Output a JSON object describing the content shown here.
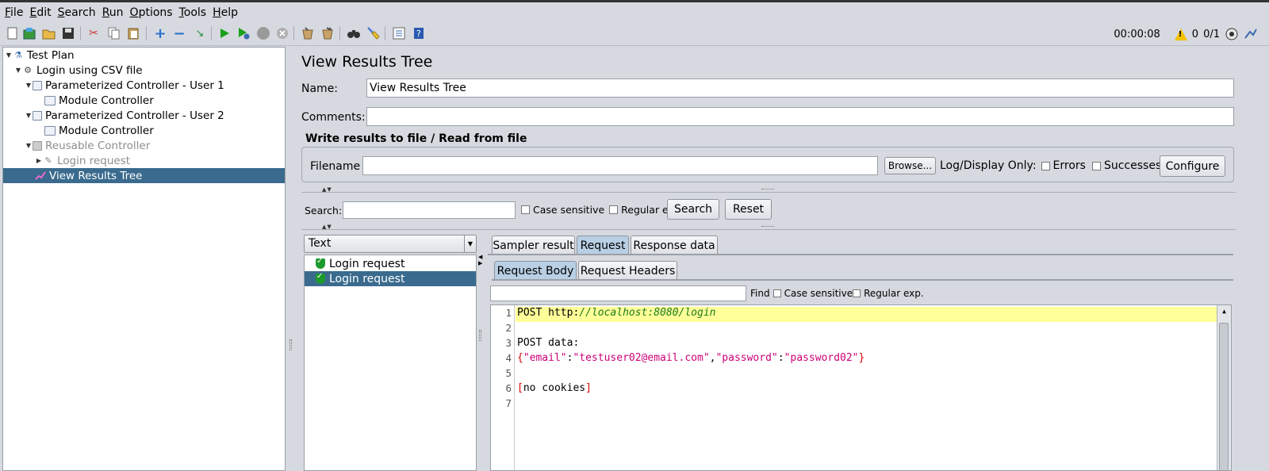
{
  "menu": [
    {
      "u": "F",
      "rest": "ile"
    },
    {
      "u": "E",
      "rest": "dit"
    },
    {
      "u": "S",
      "rest": "earch"
    },
    {
      "u": "R",
      "rest": "un"
    },
    {
      "u": "O",
      "rest": "ptions"
    },
    {
      "u": "T",
      "rest": "ools"
    },
    {
      "u": "H",
      "rest": "elp"
    }
  ],
  "status": {
    "timer": "00:00:08",
    "warnings": "0",
    "threads": "0/1"
  },
  "tree": {
    "items": [
      {
        "label": "Test Plan",
        "icon": "flask-icon"
      },
      {
        "label": "Login using CSV file",
        "icon": "gear-icon"
      },
      {
        "label": "Parameterized Controller - User 1",
        "icon": "controller-icon"
      },
      {
        "label": "Module Controller",
        "icon": "controller-icon"
      },
      {
        "label": "Parameterized Controller - User 2",
        "icon": "controller-icon"
      },
      {
        "label": "Module Controller",
        "icon": "controller-icon"
      },
      {
        "label": "Reusable Controller",
        "icon": "controller-icon"
      },
      {
        "label": "Login request",
        "icon": "pencil-icon"
      },
      {
        "label": "View Results Tree",
        "icon": "chart-icon"
      }
    ]
  },
  "panel": {
    "title": "View Results Tree",
    "name_label": "Name:",
    "name_value": "View Results Tree",
    "comments_label": "Comments:",
    "comments_value": "",
    "write_results_title": "Write results to file / Read from file",
    "filename_label": "Filename",
    "filename_value": "",
    "browse_label": "Browse...",
    "log_display_label": "Log/Display Only:",
    "errors_label": "Errors",
    "successes_label": "Successes",
    "configure_label": "Configure"
  },
  "search": {
    "label": "Search:",
    "value": "",
    "case_sensitive_label": "Case sensitive",
    "regex_label": "Regular exp.",
    "search_button": "Search",
    "reset_button": "Reset"
  },
  "results": {
    "renderer": "Text",
    "items": [
      "Login request",
      "Login request"
    ]
  },
  "tabs": {
    "top": [
      "Sampler result",
      "Request",
      "Response data"
    ],
    "sub": [
      "Request Body",
      "Request Headers"
    ]
  },
  "find": {
    "label": "Find",
    "case_sensitive_label": "Case sensitive",
    "regex_label": "Regular exp."
  },
  "editor": {
    "line_numbers": [
      "1",
      "2",
      "3",
      "4",
      "5",
      "6",
      "7"
    ],
    "line1_method": "POST http:",
    "line1_url": "//localhost:8080/login",
    "line3": "POST data:",
    "line4_open": "{",
    "line4_key1": "\"email\"",
    "line4_colon1": ":",
    "line4_val1": "\"testuser02@email.com\"",
    "line4_comma": ",",
    "line4_key2": "\"password\"",
    "line4_colon2": ":",
    "line4_val2": "\"password02\"",
    "line4_close": "}",
    "line6_open": "[",
    "line6_text": "no cookies",
    "line6_close": "]"
  }
}
